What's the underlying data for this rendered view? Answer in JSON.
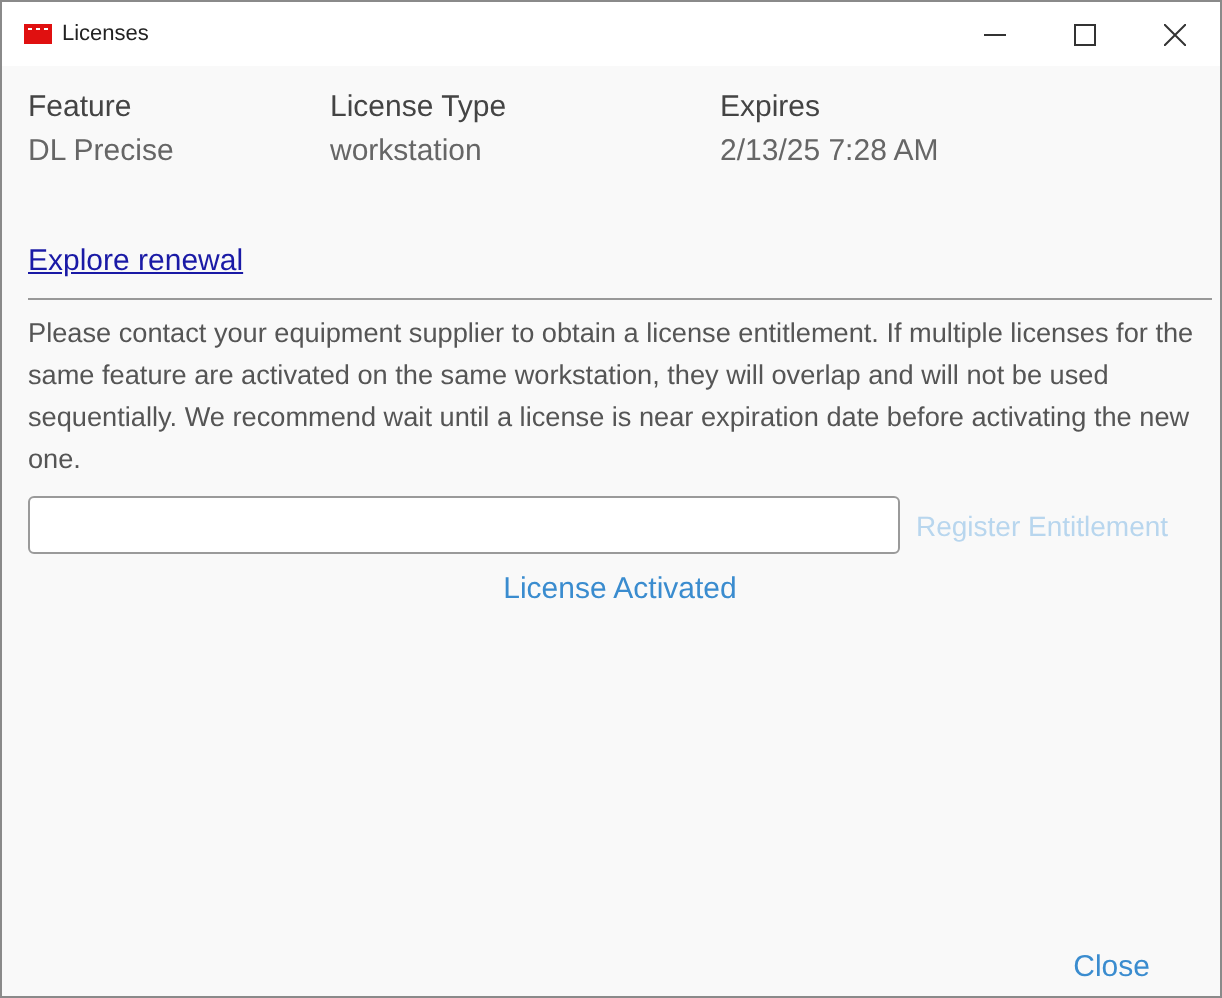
{
  "window": {
    "title": "Licenses"
  },
  "table": {
    "columns": [
      "Feature",
      "License Type",
      "Expires"
    ],
    "rows": [
      [
        "DL Precise",
        "workstation",
        "2/13/25 7:28 AM"
      ]
    ]
  },
  "renewal_link": "Explore renewal",
  "message": "Please contact your equipment supplier to obtain a license entitlement.  If multiple licenses for the same feature are activated on the same workstation, they will overlap and will not be used sequentially.  We recommend wait until a license is near expiration date before activating the new one.",
  "register_button": {
    "label": "Register Entitlement",
    "disabled": true
  },
  "status": "License Activated",
  "close_button": "Close"
}
